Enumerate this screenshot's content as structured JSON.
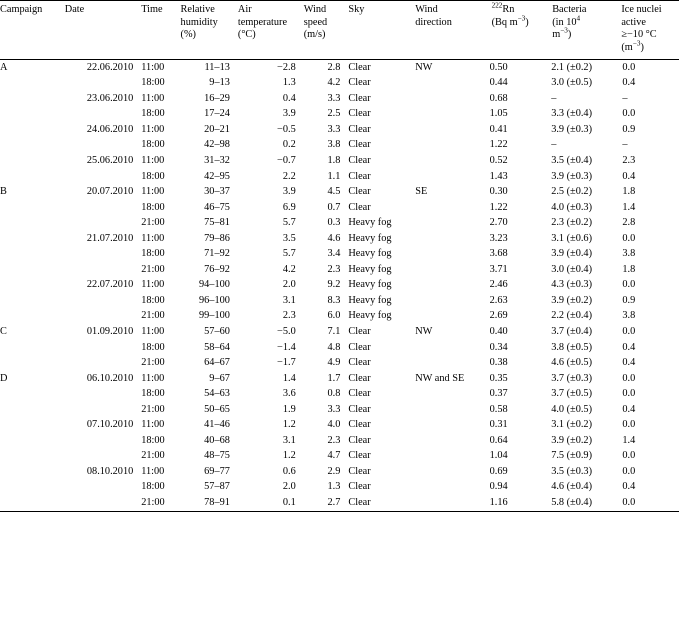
{
  "table": {
    "columns": [
      {
        "key": "campaign",
        "label": "Campaign",
        "unit": "",
        "align": "left"
      },
      {
        "key": "date",
        "label": "Date",
        "unit": "",
        "align": "right"
      },
      {
        "key": "time",
        "label": "Time",
        "unit": "",
        "align": "left"
      },
      {
        "key": "relative_humidity",
        "label": "Relative humidity",
        "unit": "(%)",
        "align": "right"
      },
      {
        "key": "air_temperature",
        "label": "Air temperature",
        "unit": "(°C)",
        "align": "right"
      },
      {
        "key": "wind_speed",
        "label": "Wind speed",
        "unit": "(m/s)",
        "align": "right"
      },
      {
        "key": "sky",
        "label": "Sky",
        "unit": "",
        "align": "left"
      },
      {
        "key": "wind_direction",
        "label": "Wind direction",
        "unit": "",
        "align": "left"
      },
      {
        "key": "radon_222",
        "label": "222Rn",
        "unit": "(Bq m-3)",
        "align": "left"
      },
      {
        "key": "bacteria",
        "label": "Bacteria",
        "unit": "(in 10^4 m-3)",
        "align": "left"
      },
      {
        "key": "ice_nuclei",
        "label": "Ice nuclei active",
        "unit": "≥-10 °C (m-3)",
        "align": "left"
      }
    ],
    "header_cells": {
      "campaign": {
        "l1": "Campaign"
      },
      "date": {
        "l1": "Date"
      },
      "time": {
        "l1": "Time"
      },
      "rh": {
        "l1": "Relative",
        "l2": "humidity",
        "l3": "(%)"
      },
      "temp": {
        "l1": "Air",
        "l2": "temperature",
        "l3": "(°C)"
      },
      "wspeed": {
        "l1": "Wind",
        "l2": "speed",
        "l3": "(m/s)"
      },
      "sky": {
        "l1": "Sky"
      },
      "wdir": {
        "l1": "Wind",
        "l2": "direction"
      },
      "rn": {
        "sup": "222",
        "l1": "Rn",
        "l2a": "(Bq m",
        "l2sup": "−3",
        "l2b": ")"
      },
      "bact": {
        "l1": "Bacteria",
        "l2a": "(in 10",
        "l2sup": "4",
        "l3a": "m",
        "l3sup": "−3",
        "l3b": ")"
      },
      "inp": {
        "l1": "Ice nuclei",
        "l2": "active",
        "l3": "≥−10 °C",
        "l4a": "(m",
        "l4sup": "−3",
        "l4b": ")"
      }
    },
    "rows": [
      {
        "campaign": "A",
        "date": "22.06.2010",
        "time": "11:00",
        "rh": "11–13",
        "temp": "−2.8",
        "wspeed": "2.8",
        "sky": "Clear",
        "wdir": "NW",
        "rn": "0.50",
        "bact": "2.1 (±0.2)",
        "inp": "0.0"
      },
      {
        "campaign": "",
        "date": "",
        "time": "18:00",
        "rh": "9–13",
        "temp": "1.3",
        "wspeed": "4.2",
        "sky": "Clear",
        "wdir": "",
        "rn": "0.44",
        "bact": "3.0 (±0.5)",
        "inp": "0.4"
      },
      {
        "campaign": "",
        "date": "23.06.2010",
        "time": "11:00",
        "rh": "16–29",
        "temp": "0.4",
        "wspeed": "3.3",
        "sky": "Clear",
        "wdir": "",
        "rn": "0.68",
        "bact": "–",
        "inp": "–"
      },
      {
        "campaign": "",
        "date": "",
        "time": "18:00",
        "rh": "17–24",
        "temp": "3.9",
        "wspeed": "2.5",
        "sky": "Clear",
        "wdir": "",
        "rn": "1.05",
        "bact": "3.3 (±0.4)",
        "inp": "0.0"
      },
      {
        "campaign": "",
        "date": "24.06.2010",
        "time": "11:00",
        "rh": "20–21",
        "temp": "−0.5",
        "wspeed": "3.3",
        "sky": "Clear",
        "wdir": "",
        "rn": "0.41",
        "bact": "3.9 (±0.3)",
        "inp": "0.9"
      },
      {
        "campaign": "",
        "date": "",
        "time": "18:00",
        "rh": "42–98",
        "temp": "0.2",
        "wspeed": "3.8",
        "sky": "Clear",
        "wdir": "",
        "rn": "1.22",
        "bact": "–",
        "inp": "–"
      },
      {
        "campaign": "",
        "date": "25.06.2010",
        "time": "11:00",
        "rh": "31–32",
        "temp": "−0.7",
        "wspeed": "1.8",
        "sky": "Clear",
        "wdir": "",
        "rn": "0.52",
        "bact": "3.5 (±0.4)",
        "inp": "2.3"
      },
      {
        "campaign": "",
        "date": "",
        "time": "18:00",
        "rh": "42–95",
        "temp": "2.2",
        "wspeed": "1.1",
        "sky": "Clear",
        "wdir": "",
        "rn": "1.43",
        "bact": "3.9 (±0.3)",
        "inp": "0.4"
      },
      {
        "campaign": "B",
        "date": "20.07.2010",
        "time": "11:00",
        "rh": "30–37",
        "temp": "3.9",
        "wspeed": "4.5",
        "sky": "Clear",
        "wdir": "SE",
        "rn": "0.30",
        "bact": "2.5 (±0.2)",
        "inp": "1.8"
      },
      {
        "campaign": "",
        "date": "",
        "time": "18:00",
        "rh": "46–75",
        "temp": "6.9",
        "wspeed": "0.7",
        "sky": "Clear",
        "wdir": "",
        "rn": "1.22",
        "bact": "4.0 (±0.3)",
        "inp": "1.4"
      },
      {
        "campaign": "",
        "date": "",
        "time": "21:00",
        "rh": "75–81",
        "temp": "5.7",
        "wspeed": "0.3",
        "sky": "Heavy fog",
        "wdir": "",
        "rn": "2.70",
        "bact": "2.3 (±0.2)",
        "inp": "2.8"
      },
      {
        "campaign": "",
        "date": "21.07.2010",
        "time": "11:00",
        "rh": "79–86",
        "temp": "3.5",
        "wspeed": "4.6",
        "sky": "Heavy fog",
        "wdir": "",
        "rn": "3.23",
        "bact": "3.1 (±0.6)",
        "inp": "0.0"
      },
      {
        "campaign": "",
        "date": "",
        "time": "18:00",
        "rh": "71–92",
        "temp": "5.7",
        "wspeed": "3.4",
        "sky": "Heavy fog",
        "wdir": "",
        "rn": "3.68",
        "bact": "3.9 (±0.4)",
        "inp": "3.8"
      },
      {
        "campaign": "",
        "date": "",
        "time": "21:00",
        "rh": "76–92",
        "temp": "4.2",
        "wspeed": "2.3",
        "sky": "Heavy fog",
        "wdir": "",
        "rn": "3.71",
        "bact": "3.0 (±0.4)",
        "inp": "1.8"
      },
      {
        "campaign": "",
        "date": "22.07.2010",
        "time": "11:00",
        "rh": "94–100",
        "temp": "2.0",
        "wspeed": "9.2",
        "sky": "Heavy fog",
        "wdir": "",
        "rn": "2.46",
        "bact": "4.3 (±0.3)",
        "inp": "0.0"
      },
      {
        "campaign": "",
        "date": "",
        "time": "18:00",
        "rh": "96–100",
        "temp": "3.1",
        "wspeed": "8.3",
        "sky": "Heavy fog",
        "wdir": "",
        "rn": "2.63",
        "bact": "3.9 (±0.2)",
        "inp": "0.9"
      },
      {
        "campaign": "",
        "date": "",
        "time": "21:00",
        "rh": "99–100",
        "temp": "2.3",
        "wspeed": "6.0",
        "sky": "Heavy fog",
        "wdir": "",
        "rn": "2.69",
        "bact": "2.2 (±0.4)",
        "inp": "3.8"
      },
      {
        "campaign": "C",
        "date": "01.09.2010",
        "time": "11:00",
        "rh": "57–60",
        "temp": "−5.0",
        "wspeed": "7.1",
        "sky": "Clear",
        "wdir": "NW",
        "rn": "0.40",
        "bact": "3.7 (±0.4)",
        "inp": "0.0"
      },
      {
        "campaign": "",
        "date": "",
        "time": "18:00",
        "rh": "58–64",
        "temp": "−1.4",
        "wspeed": "4.8",
        "sky": "Clear",
        "wdir": "",
        "rn": "0.34",
        "bact": "3.8 (±0.5)",
        "inp": "0.4"
      },
      {
        "campaign": "",
        "date": "",
        "time": "21:00",
        "rh": "64–67",
        "temp": "−1.7",
        "wspeed": "4.9",
        "sky": "Clear",
        "wdir": "",
        "rn": "0.38",
        "bact": "4.6 (±0.5)",
        "inp": "0.4"
      },
      {
        "campaign": "D",
        "date": "06.10.2010",
        "time": "11:00",
        "rh": "9–67",
        "temp": "1.4",
        "wspeed": "1.7",
        "sky": "Clear",
        "wdir": "NW and SE",
        "rn": "0.35",
        "bact": "3.7 (±0.3)",
        "inp": "0.0"
      },
      {
        "campaign": "",
        "date": "",
        "time": "18:00",
        "rh": "54–63",
        "temp": "3.6",
        "wspeed": "0.8",
        "sky": "Clear",
        "wdir": "",
        "rn": "0.37",
        "bact": "3.7 (±0.5)",
        "inp": "0.0"
      },
      {
        "campaign": "",
        "date": "",
        "time": "21:00",
        "rh": "50–65",
        "temp": "1.9",
        "wspeed": "3.3",
        "sky": "Clear",
        "wdir": "",
        "rn": "0.58",
        "bact": "4.0 (±0.5)",
        "inp": "0.4"
      },
      {
        "campaign": "",
        "date": "07.10.2010",
        "time": "11:00",
        "rh": "41–46",
        "temp": "1.2",
        "wspeed": "4.0",
        "sky": "Clear",
        "wdir": "",
        "rn": "0.31",
        "bact": "3.1 (±0.2)",
        "inp": "0.0"
      },
      {
        "campaign": "",
        "date": "",
        "time": "18:00",
        "rh": "40–68",
        "temp": "3.1",
        "wspeed": "2.3",
        "sky": "Clear",
        "wdir": "",
        "rn": "0.64",
        "bact": "3.9 (±0.2)",
        "inp": "1.4"
      },
      {
        "campaign": "",
        "date": "",
        "time": "21:00",
        "rh": "48–75",
        "temp": "1.2",
        "wspeed": "4.7",
        "sky": "Clear",
        "wdir": "",
        "rn": "1.04",
        "bact": "7.5 (±0.9)",
        "inp": "0.0"
      },
      {
        "campaign": "",
        "date": "08.10.2010",
        "time": "11:00",
        "rh": "69–77",
        "temp": "0.6",
        "wspeed": "2.9",
        "sky": "Clear",
        "wdir": "",
        "rn": "0.69",
        "bact": "3.5 (±0.3)",
        "inp": "0.0"
      },
      {
        "campaign": "",
        "date": "",
        "time": "18:00",
        "rh": "57–87",
        "temp": "2.0",
        "wspeed": "1.3",
        "sky": "Clear",
        "wdir": "",
        "rn": "0.94",
        "bact": "4.6 (±0.4)",
        "inp": "0.4"
      },
      {
        "campaign": "",
        "date": "",
        "time": "21:00",
        "rh": "78–91",
        "temp": "0.1",
        "wspeed": "2.7",
        "sky": "Clear",
        "wdir": "",
        "rn": "1.16",
        "bact": "5.8 (±0.4)",
        "inp": "0.0"
      }
    ]
  }
}
